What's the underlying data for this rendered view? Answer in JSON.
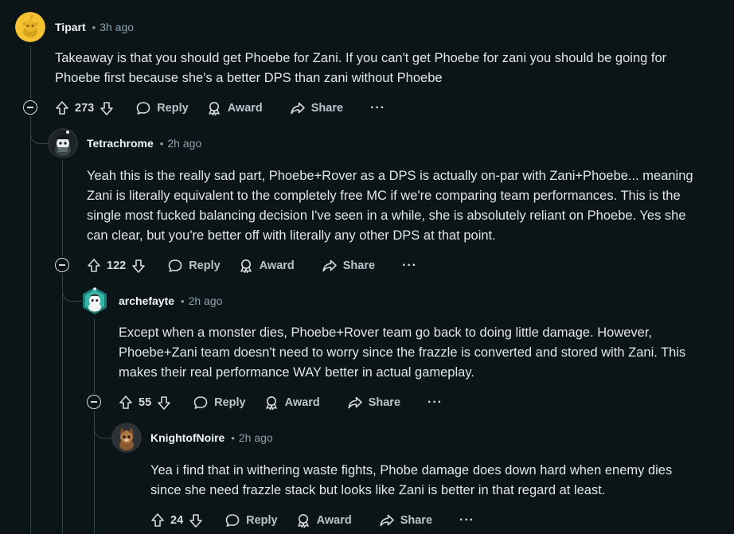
{
  "comments": [
    {
      "author": "Tipart",
      "dot": "•",
      "time": "3h ago",
      "body": [
        "Takeaway is that you should get Phoebe for Zani. If you can't get Phoebe for zani you should be going for",
        "Phoebe first because she's a better DPS than zani without Phoebe"
      ],
      "votes": "273",
      "reply": "Reply",
      "award": "Award",
      "share": "Share",
      "more": "···"
    },
    {
      "author": "Tetrachrome",
      "dot": "•",
      "time": "2h ago",
      "body": [
        "Yeah this is the really sad part, Phoebe+Rover as a DPS is actually on-par with Zani+Phoebe... meaning",
        "Zani is literally equivalent to the completely free MC if we're comparing team performances. This is the",
        "single most fucked balancing decision I've seen in a while, she is absolutely reliant on Phoebe. Yes she",
        "can clear, but you're better off with literally any other DPS at that point."
      ],
      "votes": "122",
      "reply": "Reply",
      "award": "Award",
      "share": "Share",
      "more": "···"
    },
    {
      "author": "archefayte",
      "dot": "•",
      "time": "2h ago",
      "body": [
        "Except when a monster dies, Phoebe+Rover team go back to doing little damage. However,",
        "Phoebe+Zani team doesn't need to worry since the frazzle is converted and stored with Zani. This",
        "makes their real performance WAY better in actual gameplay."
      ],
      "votes": "55",
      "reply": "Reply",
      "award": "Award",
      "share": "Share",
      "more": "···"
    },
    {
      "author": "KnightofNoire",
      "dot": "•",
      "time": "2h ago",
      "body": [
        "Yea i find that in withering waste fights, Phobe damage does down hard when enemy dies",
        "since she need frazzle stack but looks like Zani is better in that regard at least."
      ],
      "votes": "24",
      "reply": "Reply",
      "award": "Award",
      "share": "Share",
      "more": "···"
    }
  ],
  "colors": {
    "background": "#0b1416",
    "thread_line": "#33464c",
    "meta_text": "#8ba2ad"
  },
  "icons": {
    "upvote": "upvote-arrow-icon",
    "downvote": "downvote-arrow-icon",
    "reply": "speech-bubble-icon",
    "award": "award-ribbon-icon",
    "share": "share-arrow-icon",
    "collapse": "collapse-minus-icon"
  }
}
